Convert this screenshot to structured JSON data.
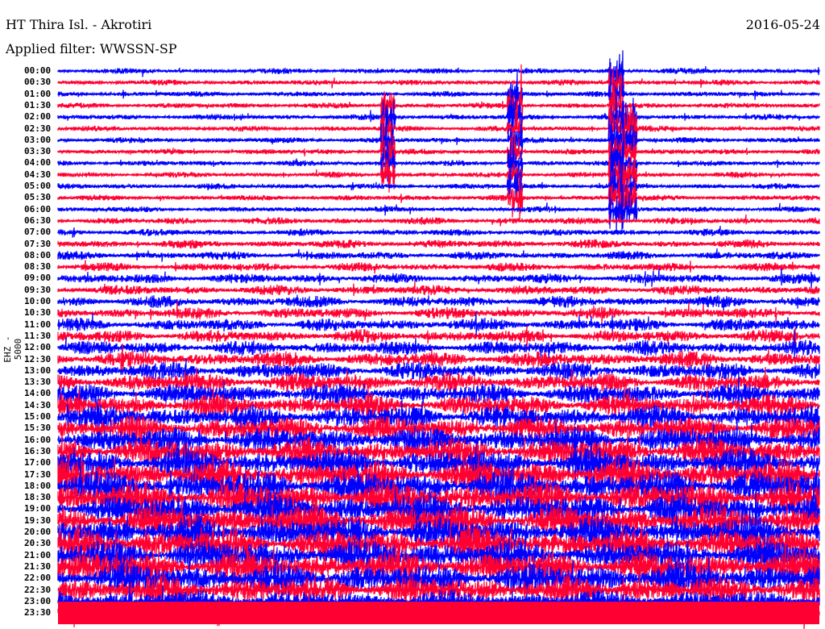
{
  "header": {
    "station": "HT Thira Isl. - Akrotiri",
    "date": "2016-05-24",
    "filter": "Applied filter: WWSSN-SP"
  },
  "chart_data": {
    "type": "line",
    "title": "HT Thira Isl. - Akrotiri",
    "ylabel": "EHZ - 5000",
    "xlabel": "",
    "row_labels": [
      "00:00",
      "00:30",
      "01:00",
      "01:30",
      "02:00",
      "02:30",
      "03:00",
      "03:30",
      "04:00",
      "04:30",
      "05:00",
      "05:30",
      "06:00",
      "06:30",
      "07:00",
      "07:30",
      "08:00",
      "08:30",
      "09:00",
      "09:30",
      "10:00",
      "10:30",
      "11:00",
      "11:30",
      "12:00",
      "12:30",
      "13:00",
      "13:30",
      "14:00",
      "14:30",
      "15:00",
      "15:30",
      "16:00",
      "16:30",
      "17:00",
      "17:30",
      "18:00",
      "18:30",
      "19:00",
      "19:30",
      "20:00",
      "20:30",
      "21:00",
      "21:30",
      "22:00",
      "22:30",
      "23:00",
      "23:30"
    ],
    "row_colors": [
      "#0000ff",
      "#ff0033"
    ],
    "noise_amplitude": [
      4,
      4,
      4,
      4,
      4,
      4,
      4,
      4,
      4,
      4,
      4,
      4,
      4,
      5,
      5,
      6,
      6,
      6,
      7,
      7,
      8,
      8,
      9,
      9,
      10,
      11,
      12,
      13,
      14,
      15,
      16,
      17,
      18,
      19,
      20,
      21,
      22,
      22,
      22,
      22,
      22,
      22,
      22,
      22,
      22,
      20,
      16,
      14
    ],
    "events": [
      {
        "row_start": 3,
        "row_end": 9,
        "minute": 13,
        "amplitude": 25
      },
      {
        "row_start": 2,
        "row_end": 11,
        "minute": 18,
        "amplitude": 30
      },
      {
        "row_start": 0,
        "row_end": 12,
        "minute": 22,
        "amplitude": 35
      },
      {
        "row_start": 4,
        "row_end": 12,
        "minute": 22.5,
        "amplitude": 30
      }
    ],
    "grid": false
  }
}
